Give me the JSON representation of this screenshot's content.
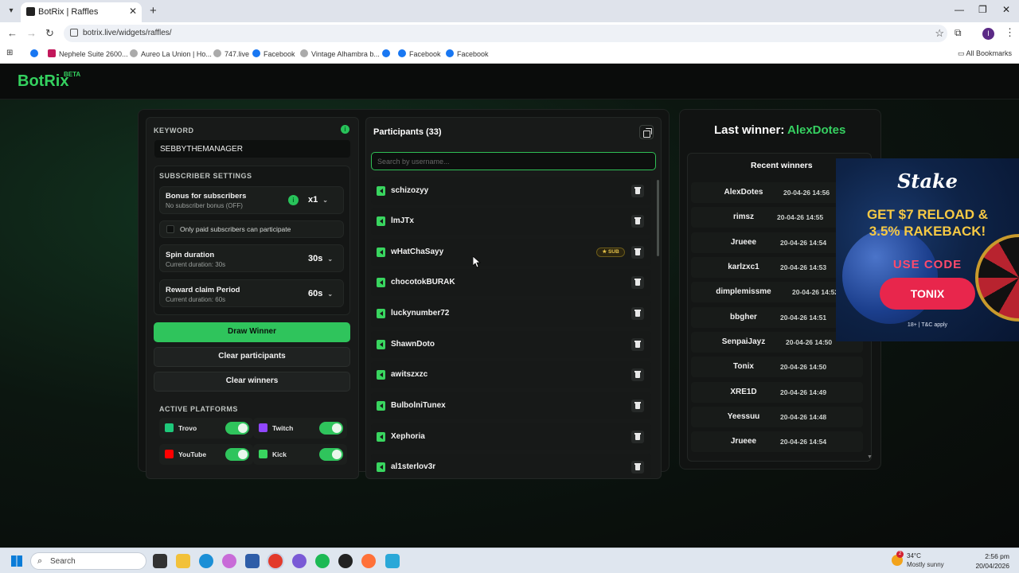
{
  "browser": {
    "tab_title": "BotRix | Raffles",
    "url": "botrix.live/widgets/raffles/",
    "bookmarks": [
      "Nephele Suite 2600...",
      "Aureo La Union | Ho...",
      "747.live",
      "Facebook",
      "Vintage Alhambra b...",
      "Facebook",
      "Facebook"
    ],
    "all_bookmarks": "All Bookmarks",
    "profile_initial": "I"
  },
  "app": {
    "logo": "BotRix",
    "beta": "BETA"
  },
  "settings": {
    "keyword_label": "KEYWORD",
    "keyword_value": "SEBBYTHEMANAGER",
    "subscriber_settings_label": "SUBSCRIBER SETTINGS",
    "bonus_title": "Bonus for subscribers",
    "bonus_sub": "No subscriber bonus (OFF)",
    "bonus_value": "x1",
    "only_paid_label": "Only paid subscribers can participate",
    "spin_title": "Spin duration",
    "spin_sub": "Current duration: 30s",
    "spin_value": "30s",
    "reward_title": "Reward claim Period",
    "reward_sub": "Current duration: 60s",
    "reward_value": "60s",
    "draw_button": "Draw Winner",
    "clear_participants_button": "Clear participants",
    "clear_winners_button": "Clear winners",
    "active_platforms_label": "ACTIVE PLATFORMS",
    "platforms": [
      "Trovo",
      "Twitch",
      "YouTube",
      "Kick"
    ]
  },
  "participants": {
    "title": "Participants (33)",
    "search_placeholder": "Search by username...",
    "sub_badge": "SUB",
    "list": [
      "schizozyy",
      "lmJTx",
      "wHatChaSayy",
      "chocotokBURAK",
      "luckynumber72",
      "ShawnDoto",
      "awitszxzc",
      "BulbolniTunex",
      "Xephoria",
      "al1sterlov3r"
    ]
  },
  "winners": {
    "last_winner_label": "Last winner:",
    "last_winner_name": "AlexDotes",
    "recent_title": "Recent winners",
    "list": [
      {
        "name": "AlexDotes",
        "time": "20-04-26 14:56"
      },
      {
        "name": "rimsz",
        "time": "20-04-26 14:55"
      },
      {
        "name": "Jrueee",
        "time": "20-04-26 14:54"
      },
      {
        "name": "karlzxc1",
        "time": "20-04-26 14:53"
      },
      {
        "name": "dimplemissme",
        "time": "20-04-26 14:52"
      },
      {
        "name": "bbgher",
        "time": "20-04-26 14:51"
      },
      {
        "name": "SenpaiJayz",
        "time": "20-04-26 14:50"
      },
      {
        "name": "Tonix",
        "time": "20-04-26 14:50"
      },
      {
        "name": "XRE1D",
        "time": "20-04-26 14:49"
      },
      {
        "name": "Yeessuu",
        "time": "20-04-26 14:48"
      },
      {
        "name": "Jrueee",
        "time": "20-04-26 14:54"
      }
    ]
  },
  "ad": {
    "brand": "Stake",
    "headline_1": "GET $7 RELOAD &",
    "headline_2": "3.5% RAKEBACK!",
    "use_code": "USE CODE",
    "code": "TONIX",
    "terms": "18+ | T&C apply"
  },
  "taskbar": {
    "search": "Search",
    "weather_temp": "34°C",
    "weather_desc": "Mostly sunny",
    "weather_badge": "2",
    "time": "2:56 pm",
    "date": "20/04/2026"
  }
}
